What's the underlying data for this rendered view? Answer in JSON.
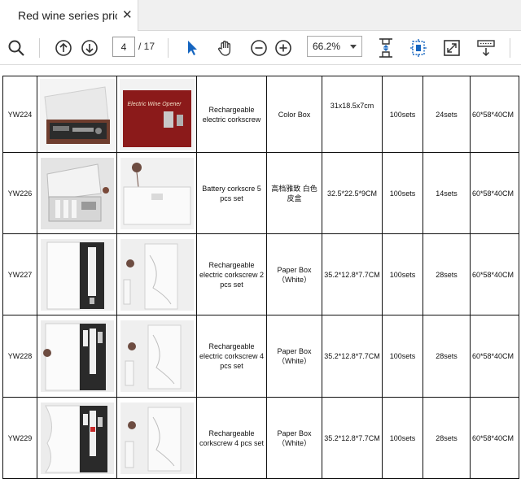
{
  "tab": {
    "title": "Red wine series pric...",
    "close_glyph": "✕"
  },
  "toolbar": {
    "current_page": "4",
    "total_pages": "/ 17",
    "zoom": "66.2%"
  },
  "table": {
    "rows": [
      {
        "code": "YW224",
        "name": "Rechargeable electric corkscrew",
        "packing": "Color Box",
        "size": "31x18.5x7cm",
        "moq": "100sets",
        "ctn_qty": "24sets",
        "carton": "60*58*40CM",
        "photo_text": "Electric Wine Opener"
      },
      {
        "code": "YW226",
        "name": "Battery corkscre 5 pcs set",
        "packing": "高档雅致 白色皮盒",
        "size": "32.5*22.5*9CM",
        "moq": "100sets",
        "ctn_qty": "14sets",
        "carton": "60*58*40CM",
        "photo_text": ""
      },
      {
        "code": "YW227",
        "name": "Rechargeable electric corkscrew 2 pcs set",
        "packing": "Paper Box（White）",
        "size": "35.2*12.8*7.7CM",
        "moq": "100sets",
        "ctn_qty": "28sets",
        "carton": "60*58*40CM",
        "photo_text": ""
      },
      {
        "code": "YW228",
        "name": "Rechargeable electric corkscrew 4 pcs set",
        "packing": "Paper Box（White）",
        "size": "35.2*12.8*7.7CM",
        "moq": "100sets",
        "ctn_qty": "28sets",
        "carton": "60*58*40CM",
        "photo_text": ""
      },
      {
        "code": "YW229",
        "name": "Rechargeable corkscrew 4 pcs set",
        "packing": "Paper Box（White）",
        "size": "35.2*12.8*7.7CM",
        "moq": "100sets",
        "ctn_qty": "28sets",
        "carton": "60*58*40CM",
        "photo_text": ""
      }
    ]
  },
  "icons": [
    "search-icon",
    "page-up-icon",
    "page-down-icon",
    "select-cursor-icon",
    "hand-tool-icon",
    "zoom-out-icon",
    "zoom-in-icon",
    "fit-page-icon",
    "rotate-view-icon",
    "fullscreen-icon",
    "more-tools-icon"
  ],
  "colors": {
    "accent": "#1565c0",
    "giftbox_red": "#8b1a1a"
  }
}
